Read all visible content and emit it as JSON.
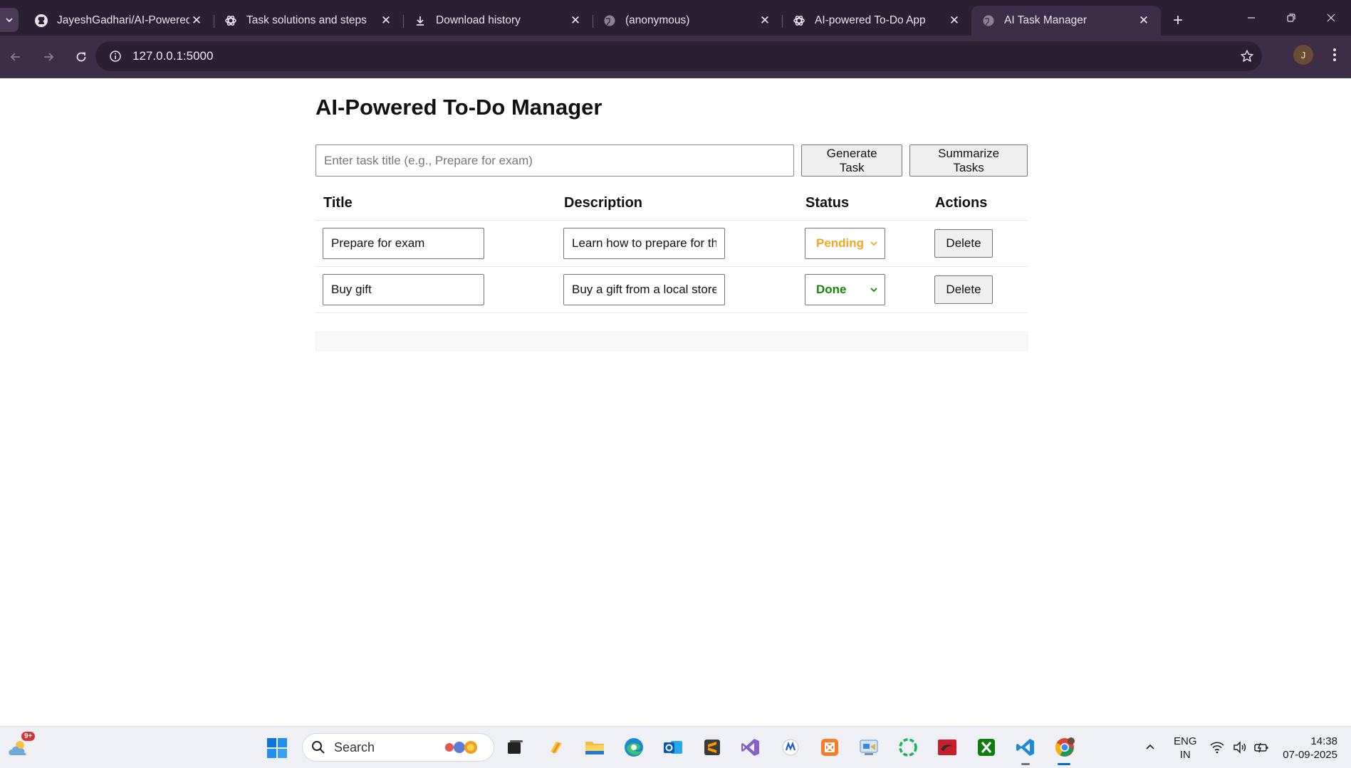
{
  "browser": {
    "tab_search_icon": "chevron-down-icon",
    "tabs": [
      {
        "title": "JayeshGadhari/AI-Powered",
        "icon": "github-icon"
      },
      {
        "title": "Task solutions and steps",
        "icon": "openai-icon"
      },
      {
        "title": "Download history",
        "icon": "download-icon"
      },
      {
        "title": "(anonymous)",
        "icon": "globe-icon"
      },
      {
        "title": "AI-powered To-Do App",
        "icon": "openai-icon"
      },
      {
        "title": "AI Task Manager",
        "icon": "globe-icon",
        "active": true
      }
    ],
    "url": "127.0.0.1:5000",
    "profile_initial": "J",
    "accent": "#2b1f34"
  },
  "app": {
    "heading": "AI-Powered To-Do Manager",
    "task_input_placeholder": "Enter task title (e.g., Prepare for exam)",
    "generate_button": "Generate Task",
    "summarize_button": "Summarize Tasks",
    "table": {
      "headers": {
        "title": "Title",
        "description": "Description",
        "status": "Status",
        "actions": "Actions"
      },
      "rows": [
        {
          "title": "Prepare for exam",
          "description": "Learn how to prepare for the",
          "status": "Pending",
          "status_color": "#f5a623",
          "action": "Delete"
        },
        {
          "title": "Buy gift",
          "description": "Buy a gift from a local store",
          "status": "Done",
          "status_color": "#138a07",
          "action": "Delete"
        }
      ]
    }
  },
  "taskbar": {
    "weather_badge": "9+",
    "search_label": "Search",
    "language": "ENG",
    "region": "IN",
    "time": "14:38",
    "date": "07-09-2025"
  }
}
